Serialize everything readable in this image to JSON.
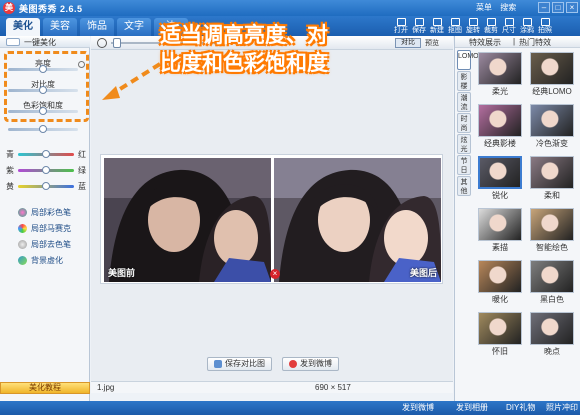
{
  "window": {
    "title": "美图秀秀 2.6.5",
    "links": [
      "菜单",
      "搜索"
    ]
  },
  "tabs": [
    "美化",
    "美容",
    "饰品",
    "文字",
    "边"
  ],
  "active_tab": "美化",
  "tools": [
    "打开",
    "保存",
    "新建",
    "抠图",
    "旋转",
    "裁剪",
    "尺寸",
    "涂鸦",
    "拍照"
  ],
  "left_panel": {
    "header": "一键美化",
    "sliders": [
      {
        "label": "亮度",
        "value": 0.5
      },
      {
        "label": "对比度",
        "value": 0.5
      },
      {
        "label": "色彩饱和度",
        "value": 0.5
      }
    ],
    "color_sliders": [
      {
        "left": "青",
        "right": "红"
      },
      {
        "left": "紫",
        "right": "绿"
      },
      {
        "left": "黄",
        "right": "蓝"
      }
    ],
    "brushes": [
      "局部彩色笔",
      "局部马赛克",
      "局部去色笔",
      "背景虚化"
    ],
    "tutorial": "美化教程"
  },
  "center": {
    "compare_button": "对比",
    "preview_label": "预览",
    "before_label": "美图前",
    "after_label": "美图后",
    "save_compare": "保存对比图",
    "send_weibo": "发到微博",
    "filename": "1.jpg",
    "dimensions": "690 × 517"
  },
  "right_panel": {
    "tabs_header": [
      "特效展示",
      "热门特效"
    ],
    "side_tabs": [
      "LOMO",
      "影楼",
      "潮流",
      "时尚",
      "炫光",
      "节日",
      "其他"
    ],
    "effects": [
      "柔光",
      "经典LOMO",
      "经典影楼",
      "冷色渐变",
      "锐化",
      "柔和",
      "素描",
      "智能绘色",
      "暖化",
      "黑白色",
      "怀旧",
      "晚点"
    ],
    "selected_effect": "锐化"
  },
  "bottom_bar": [
    "发到微博",
    "发到相册",
    "DIY礼物",
    "照片冲印"
  ],
  "annotation": {
    "line1": "适当调高亮度、对",
    "line2": "比度和色彩饱和度",
    "color": "#ff7a00"
  }
}
